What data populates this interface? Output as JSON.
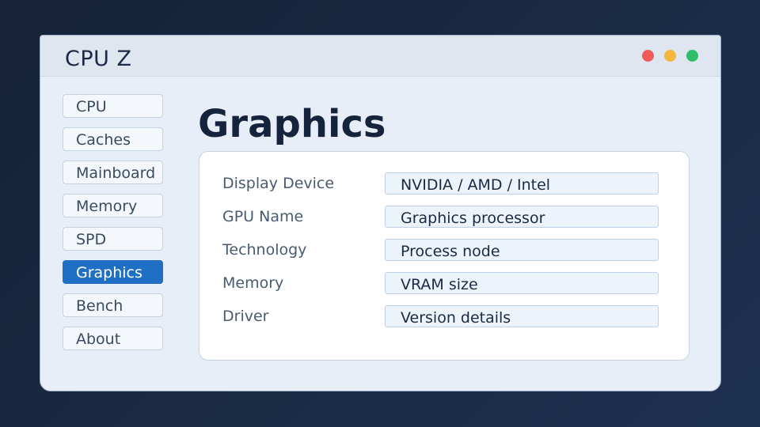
{
  "window": {
    "title": "CPU Z"
  },
  "sidebar": {
    "items": [
      {
        "label": "CPU"
      },
      {
        "label": "Caches"
      },
      {
        "label": "Mainboard"
      },
      {
        "label": "Memory"
      },
      {
        "label": "SPD"
      },
      {
        "label": "Graphics",
        "active": true
      },
      {
        "label": "Bench"
      },
      {
        "label": "About"
      }
    ]
  },
  "main": {
    "title": "Graphics",
    "rows": [
      {
        "label": "Display Device",
        "value": "NVIDIA / AMD / Intel"
      },
      {
        "label": "GPU Name",
        "value": "Graphics processor"
      },
      {
        "label": "Technology",
        "value": "Process node"
      },
      {
        "label": "Memory",
        "value": "VRAM size"
      },
      {
        "label": "Driver",
        "value": "Version details"
      }
    ]
  },
  "colors": {
    "accent": "#1f6fc4",
    "close": "#ef5a5a",
    "minimize": "#f4b73e",
    "maximize": "#2fbf6a"
  }
}
